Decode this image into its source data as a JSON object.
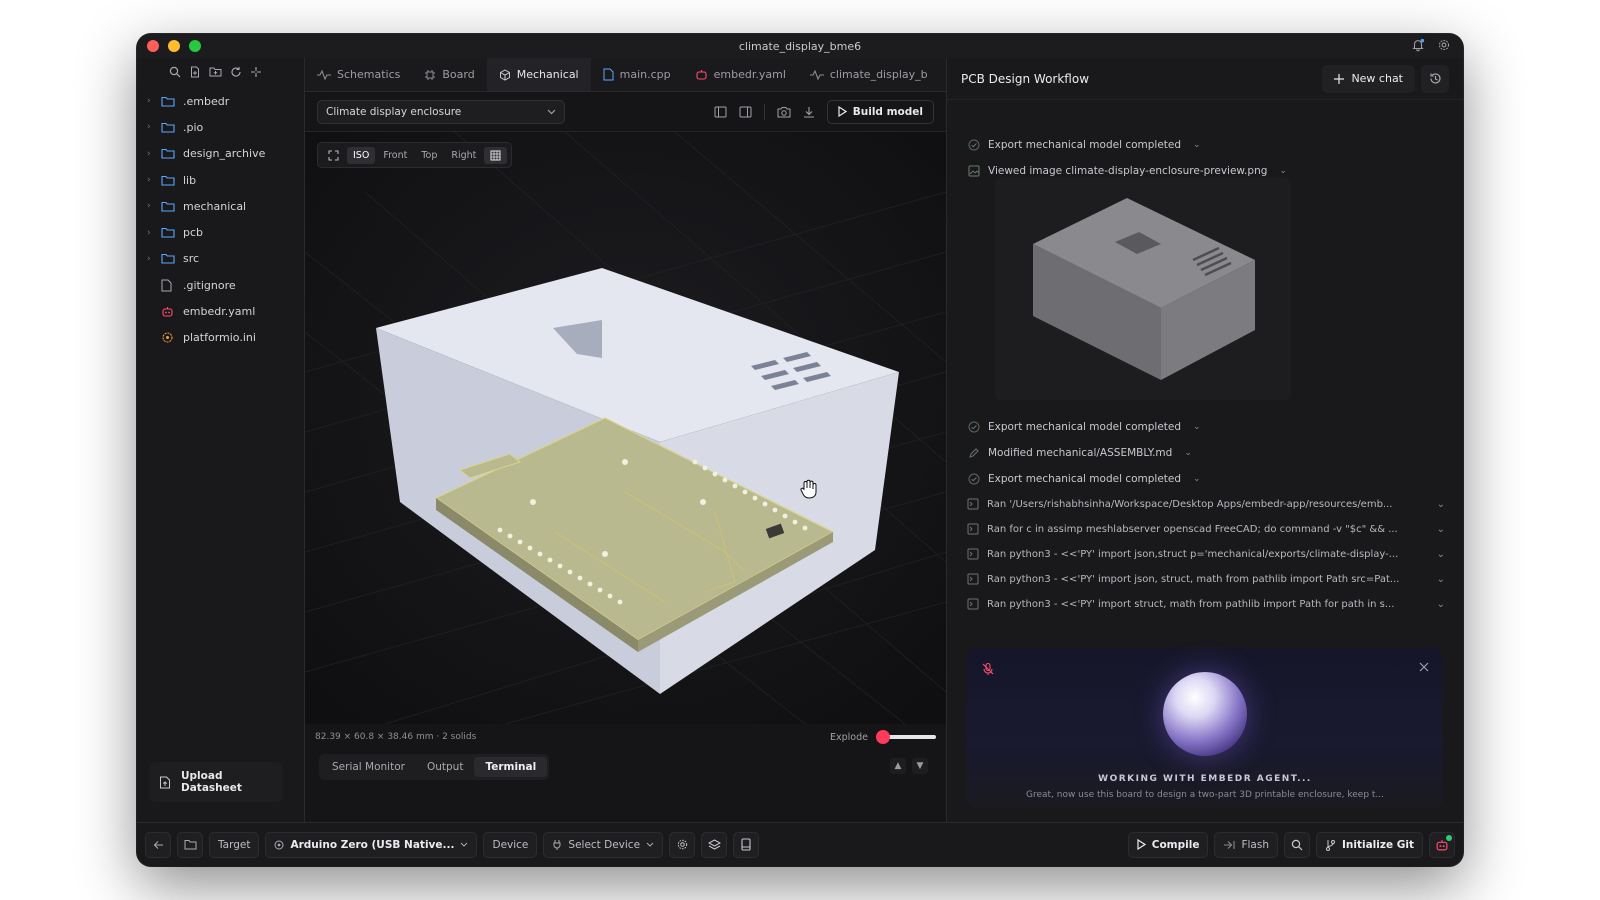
{
  "window": {
    "title": "climate_display_bme6"
  },
  "sidebar": {
    "items": [
      {
        "label": ".embedr",
        "type": "folder"
      },
      {
        "label": ".pio",
        "type": "folder"
      },
      {
        "label": "design_archive",
        "type": "folder"
      },
      {
        "label": "lib",
        "type": "folder"
      },
      {
        "label": "mechanical",
        "type": "folder"
      },
      {
        "label": "pcb",
        "type": "folder"
      },
      {
        "label": "src",
        "type": "folder"
      },
      {
        "label": ".gitignore",
        "type": "file"
      },
      {
        "label": "embedr.yaml",
        "type": "file-embedr"
      },
      {
        "label": "platformio.ini",
        "type": "file-pio"
      }
    ],
    "upload_label": "Upload Datasheet"
  },
  "tabs": [
    {
      "label": "Schematics"
    },
    {
      "label": "Board"
    },
    {
      "label": "Mechanical",
      "active": true
    },
    {
      "label": "main.cpp"
    },
    {
      "label": "embedr.yaml"
    },
    {
      "label": "climate_display_b"
    }
  ],
  "toolbar": {
    "model_select": "Climate display enclosure",
    "build_label": "Build model"
  },
  "view_tools": [
    "ISO",
    "Front",
    "Top",
    "Right"
  ],
  "viewport": {
    "dimensions_text": "82.39 × 60.8 × 38.46 mm · 2 solids",
    "explode_label": "Explode",
    "explode_value": 0
  },
  "bottom_tabs": [
    {
      "label": "Serial Monitor"
    },
    {
      "label": "Output"
    },
    {
      "label": "Terminal",
      "active": true
    }
  ],
  "right_panel": {
    "title": "PCB Design Workflow",
    "new_chat_label": "New chat",
    "activity": [
      {
        "text": "Export mechanical model completed",
        "icon": "check-circle-icon"
      },
      {
        "text": "Viewed image climate-display-enclosure-preview.png",
        "icon": "image-icon"
      },
      {
        "text": "Export mechanical model completed",
        "icon": "check-circle-icon"
      },
      {
        "text": "Modified mechanical/ASSEMBLY.md",
        "icon": "pencil-icon"
      },
      {
        "text": "Export mechanical model completed",
        "icon": "check-circle-icon"
      }
    ],
    "commands": [
      "Ran '/Users/rishabhsinha/Workspace/Desktop Apps/embedr-app/resources/emb...",
      "Ran for c in assimp meshlabserver openscad FreeCAD; do command -v \"$c\" && ...",
      "Ran python3 - <<'PY' import json,struct p='mechanical/exports/climate-display-...",
      "Ran python3 - <<'PY' import json, struct, math from pathlib import Path src=Pat...",
      "Ran python3 - <<'PY' import struct, math from pathlib import Path for path in s..."
    ],
    "agent": {
      "title": "WORKING WITH EMBEDR AGENT...",
      "subtitle": "Great, now use this board to design a two-part 3D printable enclosure, keep t..."
    }
  },
  "statusbar": {
    "target_label": "Target",
    "target_value": "Arduino Zero (USB Native...",
    "device_label": "Device",
    "device_value": "Select Device",
    "compile_label": "Compile",
    "flash_label": "Flash",
    "git_label": "Initialize Git"
  },
  "colors": {
    "accent_red": "#ff3b5c",
    "background": "#1a1a1d"
  }
}
